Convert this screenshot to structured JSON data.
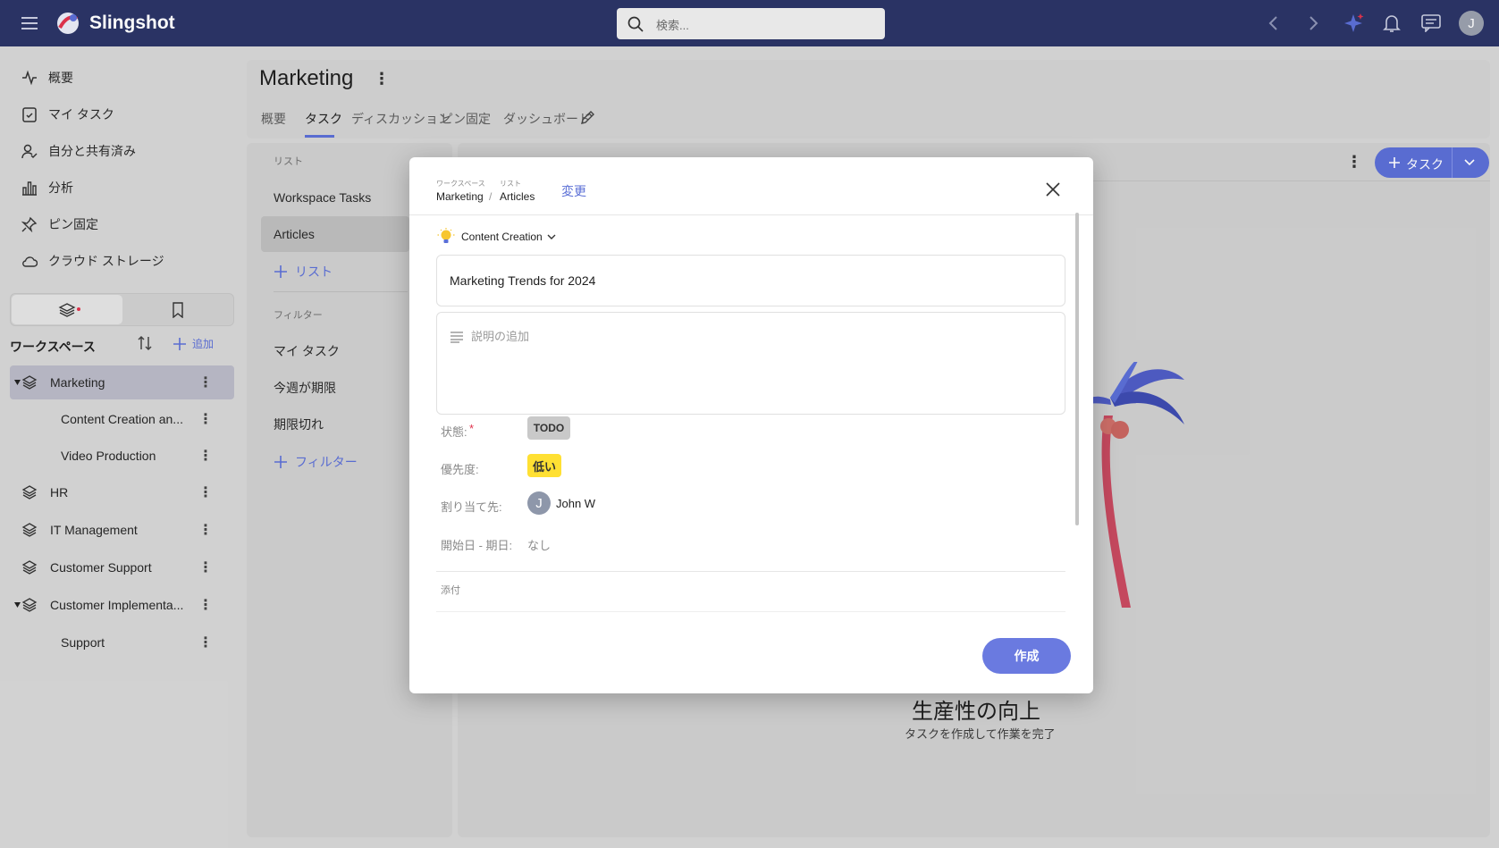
{
  "app": {
    "name": "Slingshot",
    "search_placeholder": "検索...",
    "avatar_initial": "J"
  },
  "colors": {
    "topbar": "#2b3566",
    "accent": "#5b6fd6",
    "priority_low": "#ffe033"
  },
  "sidebar": {
    "nav": [
      {
        "label": "概要",
        "icon": "activity-icon"
      },
      {
        "label": "マイ タスク",
        "icon": "clipboard-check-icon"
      },
      {
        "label": "自分と共有済み",
        "icon": "user-check-icon"
      },
      {
        "label": "分析",
        "icon": "bar-chart-icon"
      },
      {
        "label": "ピン固定",
        "icon": "pin-icon"
      },
      {
        "label": "クラウド ストレージ",
        "icon": "cloud-icon"
      }
    ],
    "workspace_header": "ワークスペース",
    "add_label": "追加",
    "workspaces": [
      {
        "label": "Marketing"
      },
      {
        "label": "Content Creation an..."
      },
      {
        "label": "Video Production"
      },
      {
        "label": "HR"
      },
      {
        "label": "IT Management"
      },
      {
        "label": "Customer Support"
      },
      {
        "label": "Customer Implementa..."
      },
      {
        "label": "Support"
      }
    ]
  },
  "main": {
    "title": "Marketing",
    "tabs": [
      "概要",
      "タスク",
      "ディスカッション",
      "ピン固定",
      "ダッシュボード"
    ],
    "active_tab": "タスク"
  },
  "lists": {
    "header": "リスト",
    "items": [
      "Workspace Tasks",
      "Articles"
    ],
    "add_list": "リスト",
    "filter_header": "フィルター",
    "filters": [
      "マイ タスク",
      "今週が期限",
      "期限切れ"
    ],
    "add_filter": "フィルター"
  },
  "toolbar": {
    "task_button": "タスク"
  },
  "empty_state": {
    "title": "生産性の向上",
    "subtitle": "タスクを作成して作業を完了"
  },
  "modal": {
    "bc_ws_caption": "ワークスペース",
    "bc_list_caption": "リスト",
    "bc_ws": "Marketing",
    "bc_sep": "/",
    "bc_list": "Articles",
    "change_link": "変更",
    "category": "Content Creation",
    "task_title": "Marketing Trends for 2024",
    "desc_placeholder": "説明の追加",
    "status_label": "状態:",
    "required_mark": "*",
    "status_value": "TODO",
    "priority_label": "優先度:",
    "priority_value": "低い",
    "assignee_label": "割り当て先:",
    "assignee_initial": "J",
    "assignee_name": "John W",
    "dates_label": "開始日 - 期日:",
    "dates_value": "なし",
    "attachments_label": "添付",
    "create_button": "作成"
  }
}
